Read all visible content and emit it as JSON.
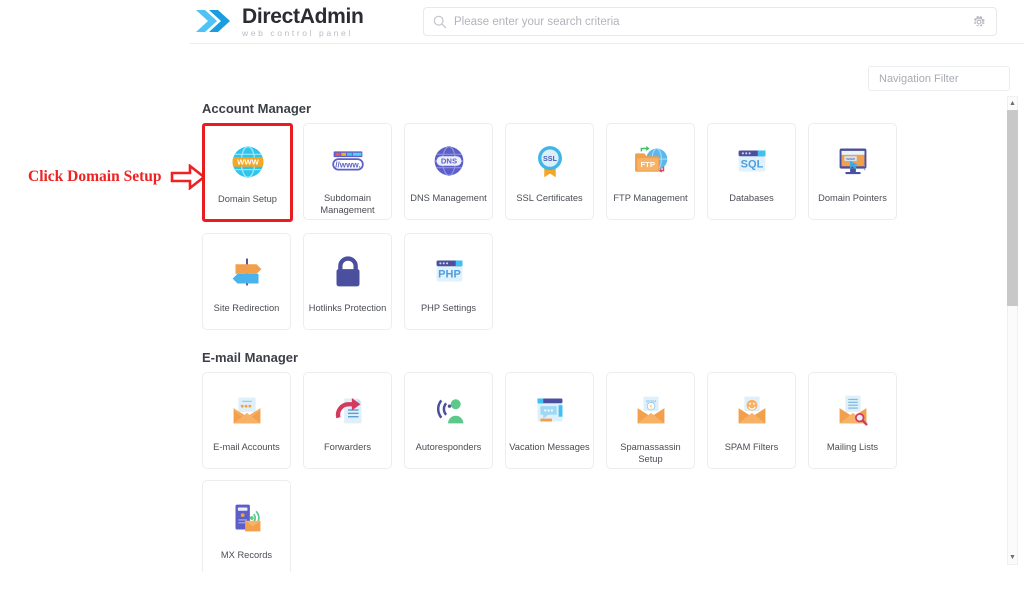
{
  "header": {
    "logo_title_a": "Direct",
    "logo_title_b": "Admin",
    "logo_subtitle": "web control panel",
    "search_placeholder": "Please enter your search criteria",
    "search_value": "",
    "settings_icon": "gear-icon",
    "search_icon": "search-icon"
  },
  "navigation_filter": {
    "placeholder": "Navigation Filter",
    "value": ""
  },
  "annotation": {
    "text": "Click Domain Setup",
    "color": "#ee2222",
    "arrow_icon": "right-arrow-outline-icon"
  },
  "colors": {
    "highlight_border": "#e81d1d",
    "tile_border": "#ededf0",
    "heading": "#3c3f47",
    "label": "#4a4d55",
    "logo_blue_light": "#4fc3f7",
    "logo_blue_dark": "#1a9de0"
  },
  "sections": [
    {
      "title": "Account Manager",
      "tiles": [
        {
          "label": "Domain Setup",
          "icon": "globe-www-icon",
          "highlighted": true
        },
        {
          "label": "Subdomain Management",
          "icon": "browser-url-icon",
          "highlighted": false
        },
        {
          "label": "DNS Management",
          "icon": "globe-dns-icon",
          "highlighted": false
        },
        {
          "label": "SSL Certificates",
          "icon": "ssl-badge-icon",
          "highlighted": false
        },
        {
          "label": "FTP Management",
          "icon": "ftp-folder-globe-icon",
          "highlighted": false
        },
        {
          "label": "Databases",
          "icon": "sql-window-icon",
          "highlighted": false
        },
        {
          "label": "Domain Pointers",
          "icon": "monitor-cursor-icon",
          "highlighted": false
        },
        {
          "label": "Site Redirection",
          "icon": "signpost-icon",
          "highlighted": false
        },
        {
          "label": "Hotlinks Protection",
          "icon": "padlock-icon",
          "highlighted": false
        },
        {
          "label": "PHP Settings",
          "icon": "php-window-icon",
          "highlighted": false
        }
      ]
    },
    {
      "title": "E-mail Manager",
      "tiles": [
        {
          "label": "E-mail Accounts",
          "icon": "open-envelope-icon",
          "highlighted": false
        },
        {
          "label": "Forwarders",
          "icon": "forward-arrow-document-icon",
          "highlighted": false
        },
        {
          "label": "Autoresponders",
          "icon": "person-soundwave-icon",
          "highlighted": false
        },
        {
          "label": "Vacation Messages",
          "icon": "chat-window-icon",
          "highlighted": false
        },
        {
          "label": "Spamassassin Setup",
          "icon": "envelope-spam-warning-icon",
          "highlighted": false
        },
        {
          "label": "SPAM Filters",
          "icon": "envelope-smiley-icon",
          "highlighted": false
        },
        {
          "label": "Mailing Lists",
          "icon": "envelope-list-magnifier-icon",
          "highlighted": false
        },
        {
          "label": "MX Records",
          "icon": "server-signal-envelope-icon",
          "highlighted": false
        }
      ]
    }
  ],
  "scrollbar": {
    "up_arrow": "▲",
    "down_arrow": "▼",
    "thumb_position_percent": 0,
    "thumb_size_percent": 45
  }
}
